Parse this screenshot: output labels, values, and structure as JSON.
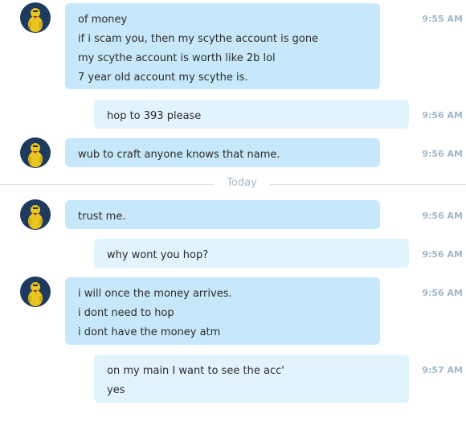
{
  "divider": {
    "label": "Today"
  },
  "messages": [
    {
      "direction": "in",
      "time": "9:55 AM",
      "lines": [
        "of money",
        "if i scam you, then my scythe account is gone",
        "my scythe account is worth like 2b lol",
        "7 year old account my scythe is."
      ]
    },
    {
      "direction": "out",
      "time": "9:56 AM",
      "lines": [
        "hop to 393 please"
      ]
    },
    {
      "direction": "in",
      "time": "9:56 AM",
      "lines": [
        "wub to craft anyone knows that name."
      ]
    },
    {
      "direction": "in",
      "time": "9:56 AM",
      "lines": [
        "trust me."
      ]
    },
    {
      "direction": "out",
      "time": "9:56 AM",
      "lines": [
        "why wont you hop?"
      ]
    },
    {
      "direction": "in",
      "time": "9:56 AM",
      "lines": [
        "i will once the money arrives.",
        "i dont need to hop",
        "i dont have the money atm"
      ]
    },
    {
      "direction": "out",
      "time": "9:57 AM",
      "lines": [
        "on my main I want to see the acc'",
        "yes"
      ]
    }
  ],
  "colors": {
    "incoming_bubble": "#c7e8fa",
    "outgoing_bubble": "#e1f3fc",
    "timestamp": "#9fb8c8",
    "avatar_bg": "#1f3a5f",
    "avatar_figure": "#e8c620"
  },
  "avatar_icon": "yellow-duck-avatar"
}
